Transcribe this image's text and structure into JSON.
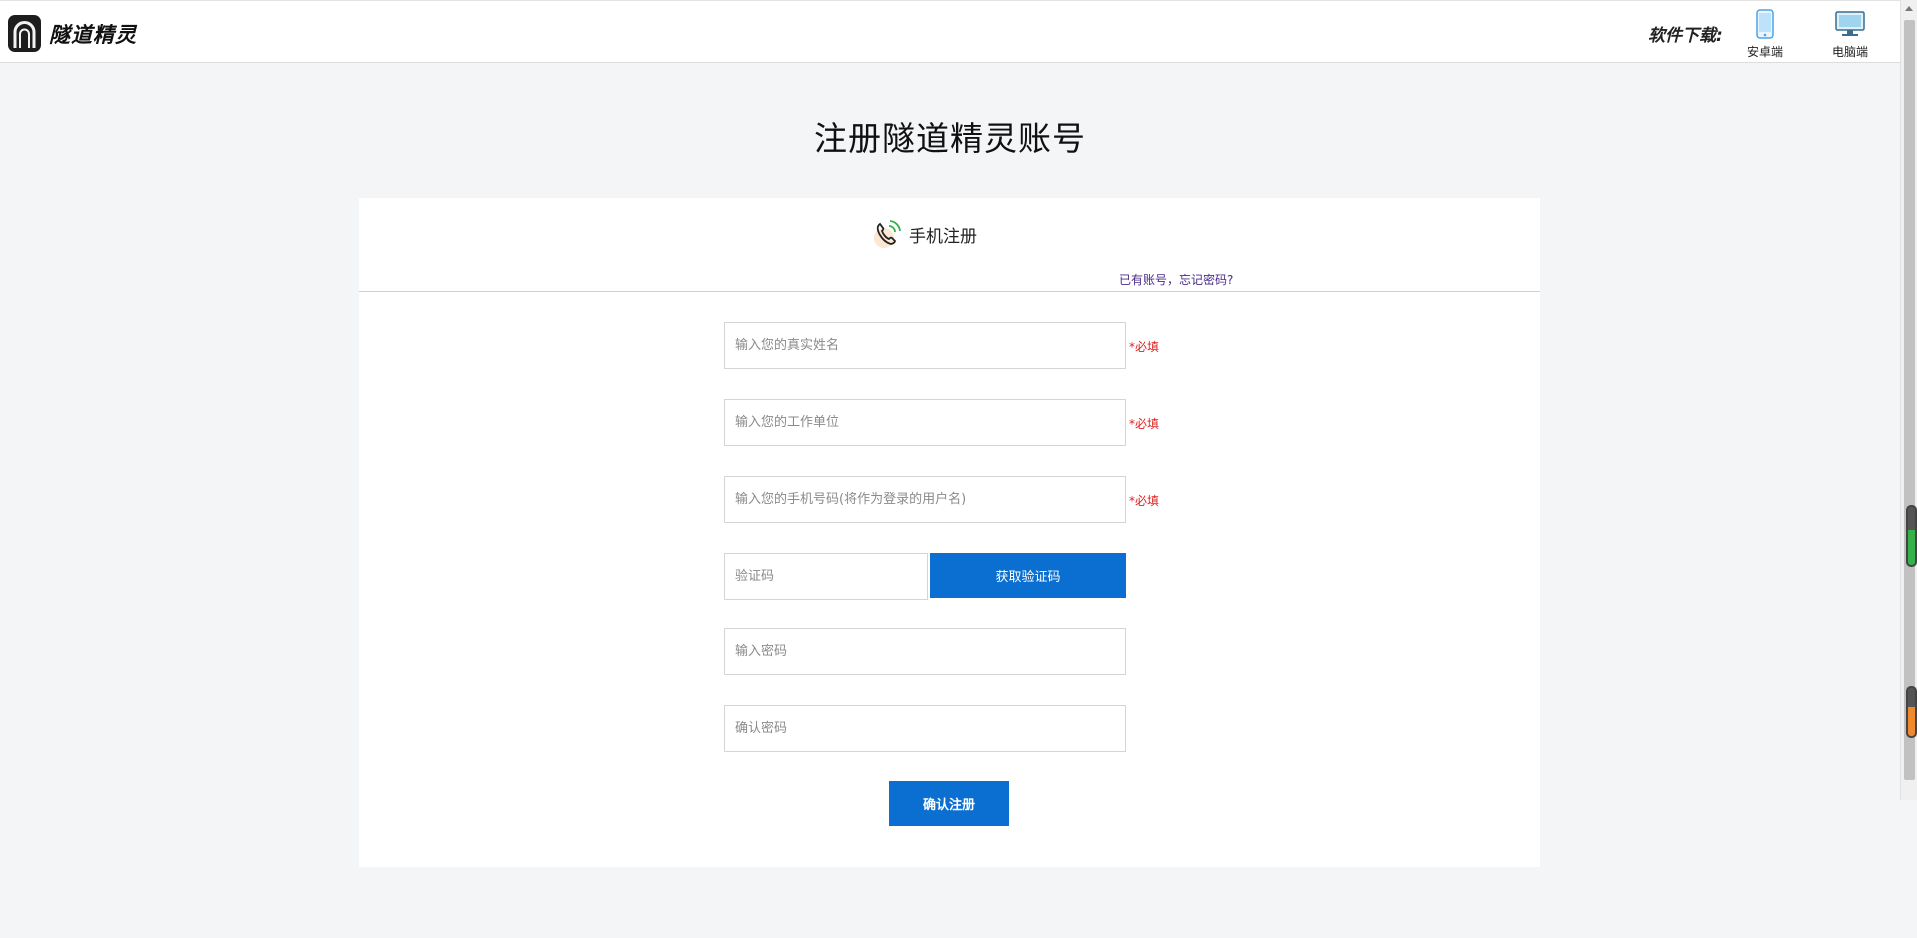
{
  "header": {
    "logo_text": "隧道精灵",
    "download_label": "软件下载:",
    "downloads": [
      {
        "label": "安卓端",
        "icon": "mobile-phone-icon"
      },
      {
        "label": "电脑端",
        "icon": "desktop-computer-icon"
      }
    ]
  },
  "page_title": "注册隧道精灵账号",
  "tabs": [
    {
      "label": "手机注册",
      "icon": "phone-call-icon",
      "active": true
    }
  ],
  "login_link": "已有账号，忘记密码?",
  "form": {
    "name_placeholder": "输入您的真实姓名",
    "company_placeholder": "输入您的工作单位",
    "phone_placeholder": "输入您的手机号码(将作为登录的用户名)",
    "code_placeholder": "验证码",
    "get_code_label": "获取验证码",
    "password_placeholder": "输入密码",
    "confirm_password_placeholder": "确认密码",
    "required_label": "*必填",
    "submit_label": "确认注册"
  },
  "colors": {
    "primary": "#0a6fd0",
    "required": "#e02020",
    "background": "#f4f5f7",
    "link": "#4a2a8a"
  }
}
